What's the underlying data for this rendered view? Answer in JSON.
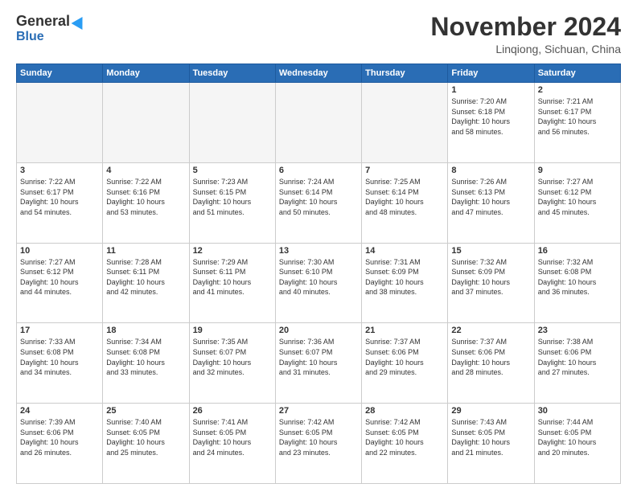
{
  "header": {
    "logo_general": "General",
    "logo_blue": "Blue",
    "month_title": "November 2024",
    "location": "Linqiong, Sichuan, China"
  },
  "weekdays": [
    "Sunday",
    "Monday",
    "Tuesday",
    "Wednesday",
    "Thursday",
    "Friday",
    "Saturday"
  ],
  "weeks": [
    [
      {
        "day": "",
        "info": ""
      },
      {
        "day": "",
        "info": ""
      },
      {
        "day": "",
        "info": ""
      },
      {
        "day": "",
        "info": ""
      },
      {
        "day": "",
        "info": ""
      },
      {
        "day": "1",
        "info": "Sunrise: 7:20 AM\nSunset: 6:18 PM\nDaylight: 10 hours\nand 58 minutes."
      },
      {
        "day": "2",
        "info": "Sunrise: 7:21 AM\nSunset: 6:17 PM\nDaylight: 10 hours\nand 56 minutes."
      }
    ],
    [
      {
        "day": "3",
        "info": "Sunrise: 7:22 AM\nSunset: 6:17 PM\nDaylight: 10 hours\nand 54 minutes."
      },
      {
        "day": "4",
        "info": "Sunrise: 7:22 AM\nSunset: 6:16 PM\nDaylight: 10 hours\nand 53 minutes."
      },
      {
        "day": "5",
        "info": "Sunrise: 7:23 AM\nSunset: 6:15 PM\nDaylight: 10 hours\nand 51 minutes."
      },
      {
        "day": "6",
        "info": "Sunrise: 7:24 AM\nSunset: 6:14 PM\nDaylight: 10 hours\nand 50 minutes."
      },
      {
        "day": "7",
        "info": "Sunrise: 7:25 AM\nSunset: 6:14 PM\nDaylight: 10 hours\nand 48 minutes."
      },
      {
        "day": "8",
        "info": "Sunrise: 7:26 AM\nSunset: 6:13 PM\nDaylight: 10 hours\nand 47 minutes."
      },
      {
        "day": "9",
        "info": "Sunrise: 7:27 AM\nSunset: 6:12 PM\nDaylight: 10 hours\nand 45 minutes."
      }
    ],
    [
      {
        "day": "10",
        "info": "Sunrise: 7:27 AM\nSunset: 6:12 PM\nDaylight: 10 hours\nand 44 minutes."
      },
      {
        "day": "11",
        "info": "Sunrise: 7:28 AM\nSunset: 6:11 PM\nDaylight: 10 hours\nand 42 minutes."
      },
      {
        "day": "12",
        "info": "Sunrise: 7:29 AM\nSunset: 6:11 PM\nDaylight: 10 hours\nand 41 minutes."
      },
      {
        "day": "13",
        "info": "Sunrise: 7:30 AM\nSunset: 6:10 PM\nDaylight: 10 hours\nand 40 minutes."
      },
      {
        "day": "14",
        "info": "Sunrise: 7:31 AM\nSunset: 6:09 PM\nDaylight: 10 hours\nand 38 minutes."
      },
      {
        "day": "15",
        "info": "Sunrise: 7:32 AM\nSunset: 6:09 PM\nDaylight: 10 hours\nand 37 minutes."
      },
      {
        "day": "16",
        "info": "Sunrise: 7:32 AM\nSunset: 6:08 PM\nDaylight: 10 hours\nand 36 minutes."
      }
    ],
    [
      {
        "day": "17",
        "info": "Sunrise: 7:33 AM\nSunset: 6:08 PM\nDaylight: 10 hours\nand 34 minutes."
      },
      {
        "day": "18",
        "info": "Sunrise: 7:34 AM\nSunset: 6:08 PM\nDaylight: 10 hours\nand 33 minutes."
      },
      {
        "day": "19",
        "info": "Sunrise: 7:35 AM\nSunset: 6:07 PM\nDaylight: 10 hours\nand 32 minutes."
      },
      {
        "day": "20",
        "info": "Sunrise: 7:36 AM\nSunset: 6:07 PM\nDaylight: 10 hours\nand 31 minutes."
      },
      {
        "day": "21",
        "info": "Sunrise: 7:37 AM\nSunset: 6:06 PM\nDaylight: 10 hours\nand 29 minutes."
      },
      {
        "day": "22",
        "info": "Sunrise: 7:37 AM\nSunset: 6:06 PM\nDaylight: 10 hours\nand 28 minutes."
      },
      {
        "day": "23",
        "info": "Sunrise: 7:38 AM\nSunset: 6:06 PM\nDaylight: 10 hours\nand 27 minutes."
      }
    ],
    [
      {
        "day": "24",
        "info": "Sunrise: 7:39 AM\nSunset: 6:06 PM\nDaylight: 10 hours\nand 26 minutes."
      },
      {
        "day": "25",
        "info": "Sunrise: 7:40 AM\nSunset: 6:05 PM\nDaylight: 10 hours\nand 25 minutes."
      },
      {
        "day": "26",
        "info": "Sunrise: 7:41 AM\nSunset: 6:05 PM\nDaylight: 10 hours\nand 24 minutes."
      },
      {
        "day": "27",
        "info": "Sunrise: 7:42 AM\nSunset: 6:05 PM\nDaylight: 10 hours\nand 23 minutes."
      },
      {
        "day": "28",
        "info": "Sunrise: 7:42 AM\nSunset: 6:05 PM\nDaylight: 10 hours\nand 22 minutes."
      },
      {
        "day": "29",
        "info": "Sunrise: 7:43 AM\nSunset: 6:05 PM\nDaylight: 10 hours\nand 21 minutes."
      },
      {
        "day": "30",
        "info": "Sunrise: 7:44 AM\nSunset: 6:05 PM\nDaylight: 10 hours\nand 20 minutes."
      }
    ]
  ]
}
